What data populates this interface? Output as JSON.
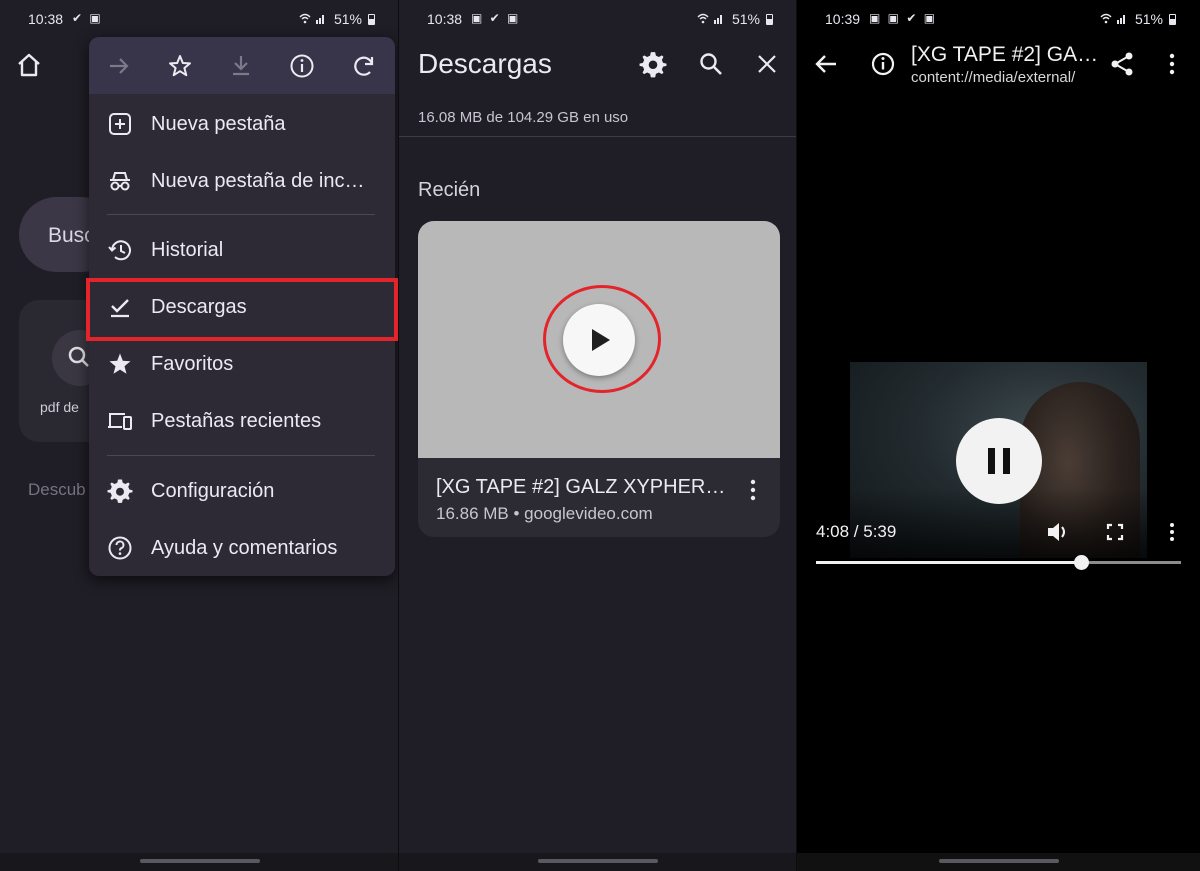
{
  "panel1": {
    "status": {
      "time": "10:38",
      "icons": "✔ ▣",
      "battery": "51%"
    },
    "background": {
      "search_text": "Busc",
      "shortcut_label": "pdf de",
      "discover_text": "Descub"
    },
    "menu": {
      "toolbar": [
        "forward-icon",
        "star-icon",
        "download-icon",
        "info-icon",
        "refresh-icon"
      ],
      "items": [
        {
          "label": "Nueva pestaña",
          "icon": "new-tab-icon"
        },
        {
          "label": "Nueva pestaña de inc…",
          "icon": "incognito-icon"
        },
        {
          "label": "Historial",
          "icon": "history-icon"
        },
        {
          "label": "Descargas",
          "icon": "downloads-icon"
        },
        {
          "label": "Favoritos",
          "icon": "bookmarks-icon"
        },
        {
          "label": "Pestañas recientes",
          "icon": "devices-icon"
        },
        {
          "label": "Configuración",
          "icon": "settings-icon"
        },
        {
          "label": "Ayuda y comentarios",
          "icon": "help-icon"
        }
      ]
    },
    "highlight_color": "#e3252b"
  },
  "panel2": {
    "status": {
      "time": "10:38",
      "icons": "▣ ✔ ▣",
      "battery": "51%"
    },
    "title": "Descargas",
    "usage": "16.08 MB de 104.29 GB en uso",
    "section": "Recién",
    "item": {
      "name": "[XG TAPE #2] GALZ XYPHER…",
      "meta": "16.86 MB • googlevideo.com"
    }
  },
  "panel3": {
    "status": {
      "time": "10:39",
      "icons": "▣ ▣ ✔ ▣",
      "battery": "51%"
    },
    "title": "[XG TAPE #2] GA…",
    "subtitle": "content://media/external/",
    "player": {
      "current": "4:08",
      "duration": "5:39",
      "time_text": "4:08  /  5:39",
      "progress": 0.727
    }
  }
}
